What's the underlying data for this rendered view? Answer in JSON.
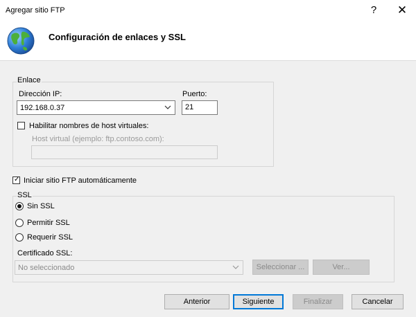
{
  "window": {
    "title": "Agregar sitio FTP",
    "help_label": "?",
    "close_label": "✕"
  },
  "header": {
    "title": "Configuración de enlaces y SSL",
    "icon": "globe-icon"
  },
  "binding": {
    "group_label": "Enlace",
    "ip_label": "Dirección IP:",
    "ip_value": "192.168.0.37",
    "port_label": "Puerto:",
    "port_value": "21",
    "virtual_host_checkbox_label": "Habilitar nombres de host virtuales:",
    "virtual_host_checked": false,
    "virtual_host_label": "Host virtual (ejemplo: ftp.contoso.com):",
    "virtual_host_value": ""
  },
  "auto_start": {
    "label": "Iniciar sitio FTP automáticamente",
    "checked": true
  },
  "ssl": {
    "group_label": "SSL",
    "options": [
      {
        "label": "Sin SSL",
        "selected": true
      },
      {
        "label": "Permitir SSL",
        "selected": false
      },
      {
        "label": "Requerir SSL",
        "selected": false
      }
    ],
    "cert_label": "Certificado SSL:",
    "cert_value": "No seleccionado",
    "select_button": "Seleccionar ...",
    "view_button": "Ver..."
  },
  "footer": {
    "previous": "Anterior",
    "next": "Siguiente",
    "finish": "Finalizar",
    "cancel": "Cancelar"
  }
}
